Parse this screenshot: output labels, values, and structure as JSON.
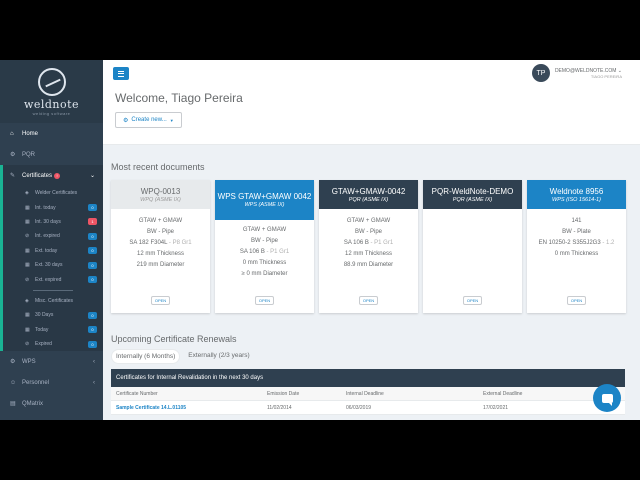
{
  "app": {
    "logo_text": "weldnote",
    "logo_sub": "welding software"
  },
  "sidebar": {
    "home": "Home",
    "pqr": "PQR",
    "certificates": "Certificates",
    "cert_alert": "!",
    "cert_items": [
      {
        "label": "Welder Certificates",
        "badge": ""
      },
      {
        "label": "Int. today",
        "badge": "0"
      },
      {
        "label": "Int. 30 days",
        "badge": "1"
      },
      {
        "label": "Int. expired",
        "badge": "0"
      },
      {
        "label": "Ext. today",
        "badge": "0"
      },
      {
        "label": "Ext. 30 days",
        "badge": "0"
      },
      {
        "label": "Ext. expired",
        "badge": "0"
      }
    ],
    "misc_items": [
      {
        "label": "Misc. Certificates",
        "badge": ""
      },
      {
        "label": "30 Days",
        "badge": "0"
      },
      {
        "label": "Today",
        "badge": "0"
      },
      {
        "label": "Expired",
        "badge": "0"
      }
    ],
    "wps": "WPS",
    "personnel": "Personnel",
    "qmatrix": "QMatrix"
  },
  "header": {
    "avatar_initials": "TP",
    "user_email": "DEMO@WELDNOTE.COM",
    "user_name": "TIAGO PEREIRA",
    "welcome": "Welcome, Tiago Pereira",
    "create_label": "Create new..."
  },
  "recent": {
    "title": "Most recent documents",
    "open_label": "OPEN",
    "cards": [
      {
        "title": "WPQ-0013",
        "subtitle": "WPQ (ASME IX)",
        "style": "grey",
        "lines": [
          [
            "GTAW + GMAW",
            ""
          ],
          [
            "BW - Pipe",
            ""
          ],
          [
            "SA 182 F304L",
            " - P8 Gr1"
          ],
          [
            "12 mm",
            " Thickness"
          ],
          [
            "219 mm",
            " Diameter"
          ]
        ]
      },
      {
        "title": "WPS GTAW+GMAW 0042",
        "subtitle": "WPS (ASME IX)",
        "style": "blue",
        "lines": [
          [
            "GTAW + GMAW",
            ""
          ],
          [
            "BW - Pipe",
            ""
          ],
          [
            "SA 106 B",
            " - P1 Gr1"
          ],
          [
            "0 mm",
            " Thickness"
          ],
          [
            "≥ 0 mm",
            " Diameter"
          ]
        ]
      },
      {
        "title": "GTAW+GMAW-0042",
        "subtitle": "PQR (ASME IX)",
        "style": "dark",
        "lines": [
          [
            "GTAW + GMAW",
            ""
          ],
          [
            "BW - Pipe",
            ""
          ],
          [
            "SA 106 B",
            " - P1 Gr1"
          ],
          [
            "12 mm",
            " Thickness"
          ],
          [
            "88.9 mm",
            " Diameter"
          ]
        ]
      },
      {
        "title": "PQR-WeldNote-DEMO",
        "subtitle": "PQR (ASME IX)",
        "style": "dark",
        "lines": []
      },
      {
        "title": "Weldnote 8956",
        "subtitle": "WPS (ISO 15614-1)",
        "style": "blue",
        "lines": [
          [
            "141",
            ""
          ],
          [
            "BW - Plate",
            ""
          ],
          [
            "EN 10250-2 S355J2G3",
            " - 1.2"
          ],
          [
            "0 mm",
            " Thickness"
          ]
        ]
      }
    ]
  },
  "renewals": {
    "title": "Upcoming Certificate Renewals",
    "tabs": [
      "Internally (6 Months)",
      "Externally (2/3 years)"
    ],
    "table_title": "Certificates for Internal Revalidation in the next 30 days",
    "columns": [
      "Certificate Number",
      "Emission Date",
      "Internal Deadline",
      "External Deadline"
    ],
    "rows": [
      [
        "Sample Certificate 14.L.01105",
        "11/02/2014",
        "06/03/2019",
        "17/02/2021"
      ]
    ]
  },
  "colors": {
    "accent": "#1c84c6",
    "sidebar": "#2f4050",
    "alert": "#ed5565",
    "active_border": "#1ab394"
  }
}
